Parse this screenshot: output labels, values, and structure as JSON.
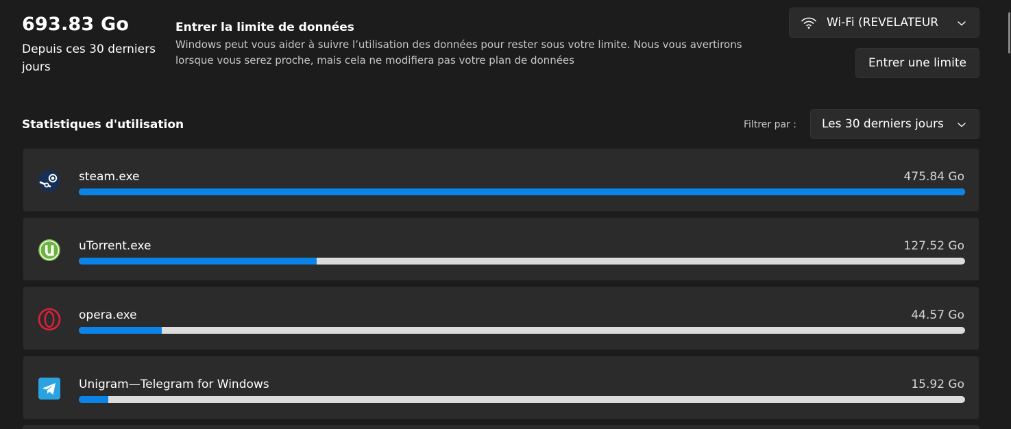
{
  "summary": {
    "total": "693.83 Go",
    "period": "Depuis ces 30 derniers jours"
  },
  "data_limit": {
    "title": "Entrer la limite de données",
    "description": "Windows peut vous aider à suivre l’utilisation des données pour rester sous votre limite. Nous vous avertirons lorsque vous serez proche, mais cela ne modifiera pas votre plan de données",
    "button_label": "Entrer une limite"
  },
  "network": {
    "selected": "Wi-Fi (REVELATEUR",
    "icon": "wifi-icon"
  },
  "stats": {
    "heading": "Statistiques d'utilisation",
    "filter_label": "Filtrer par :",
    "filter_value": "Les 30 derniers jours"
  },
  "apps": [
    {
      "name": "steam.exe",
      "usage": "475.84 Go",
      "fraction": 1.0,
      "icon": "steam-icon"
    },
    {
      "name": "uTorrent.exe",
      "usage": "127.52 Go",
      "fraction": 0.268,
      "icon": "utorrent-icon"
    },
    {
      "name": "opera.exe",
      "usage": "44.57 Go",
      "fraction": 0.0937,
      "icon": "opera-icon"
    },
    {
      "name": "Unigram—Telegram for Windows",
      "usage": "15.92 Go",
      "fraction": 0.0335,
      "icon": "telegram-icon"
    }
  ],
  "colors": {
    "background": "#1c1c1c",
    "card": "#2b2b2b",
    "bar_fill": "#0a84e8",
    "bar_track": "#dcdcdc",
    "utorrent": "#6cb33f",
    "opera": "#e0203a",
    "telegram": "#2aa3e0",
    "steam": "#1b2f4e"
  }
}
